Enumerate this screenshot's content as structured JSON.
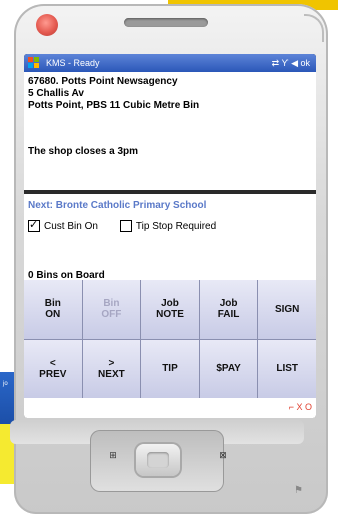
{
  "window": {
    "title": "KMS - Ready"
  },
  "status_icons": [
    "sync-icon",
    "signal-icon",
    "volume-icon",
    "ok-icon"
  ],
  "status_text": "⇄ Ƴ ◀ ok",
  "job": {
    "address_line1": "67680. Potts Point Newsagency",
    "address_line2": "5 Challis Av",
    "address_line3": "Potts Point, PBS 11 Cubic Metre Bin",
    "note": "The shop closes a 3pm"
  },
  "next": {
    "label": "Next: Bronte Catholic Primary School"
  },
  "checkboxes": [
    {
      "label": "Cust Bin On",
      "checked": true
    },
    {
      "label": "Tip Stop Required",
      "checked": false
    }
  ],
  "bins_on_board": "0 Bins on Board",
  "buttons": [
    {
      "label": "Bin\nON",
      "enabled": true
    },
    {
      "label": "Bin\nOFF",
      "enabled": false
    },
    {
      "label": "Job\nNOTE",
      "enabled": true
    },
    {
      "label": "Job\nFAIL",
      "enabled": true
    },
    {
      "label": "SIGN",
      "enabled": true
    },
    {
      "label": "<\nPREV",
      "enabled": true
    },
    {
      "label": ">\nNEXT",
      "enabled": true
    },
    {
      "label": "TIP",
      "enabled": true
    },
    {
      "label": "$PAY",
      "enabled": true
    },
    {
      "label": "LIST",
      "enabled": true
    }
  ],
  "bottom_icons": "⌐ X O",
  "background": {
    "blue_card_text": "jo"
  },
  "colors": {
    "titlebar": "#2b57b8",
    "next_text": "#5a79c8",
    "button_bg": "#d8daf0"
  }
}
